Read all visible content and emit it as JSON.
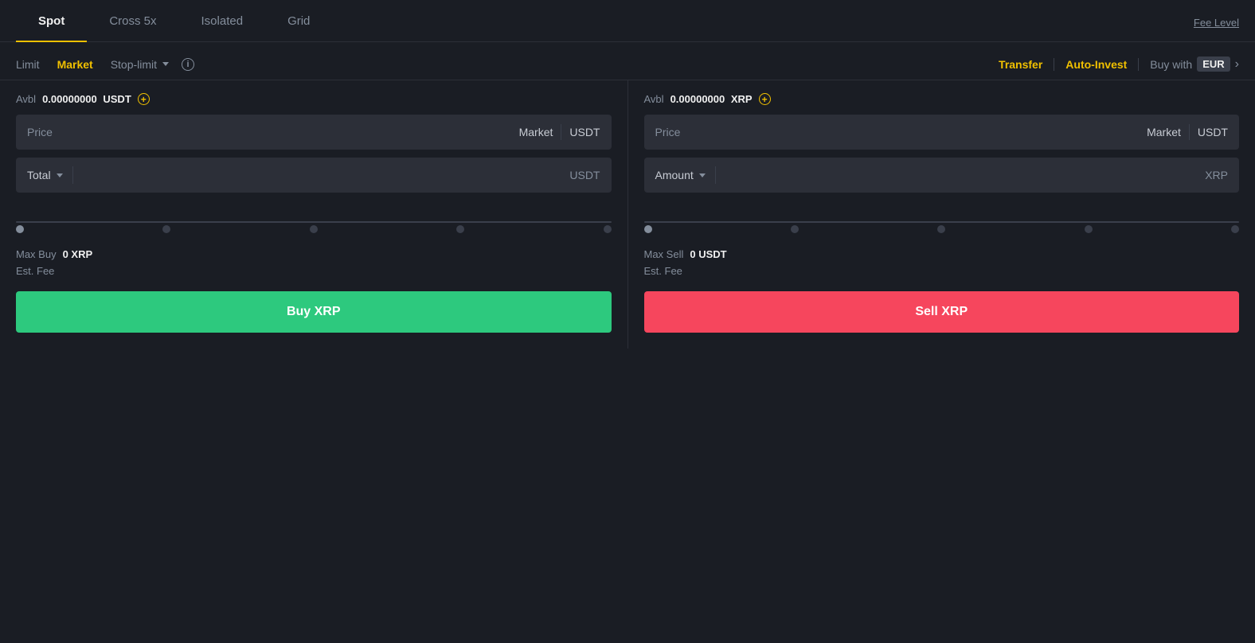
{
  "tabs": [
    {
      "id": "spot",
      "label": "Spot",
      "active": true
    },
    {
      "id": "cross5x",
      "label": "Cross 5x",
      "active": false
    },
    {
      "id": "isolated",
      "label": "Isolated",
      "active": false
    },
    {
      "id": "grid",
      "label": "Grid",
      "active": false
    }
  ],
  "fee_level": "Fee Level",
  "order_types": [
    {
      "id": "limit",
      "label": "Limit",
      "active": false
    },
    {
      "id": "market",
      "label": "Market",
      "active": true
    },
    {
      "id": "stop_limit",
      "label": "Stop-limit",
      "active": false
    }
  ],
  "right_actions": {
    "transfer": "Transfer",
    "auto_invest": "Auto-Invest",
    "buy_with": "Buy with",
    "currency": "EUR"
  },
  "buy_panel": {
    "avbl_label": "Avbl",
    "avbl_amount": "0.00000000",
    "avbl_currency": "USDT",
    "price_placeholder": "Price",
    "price_market": "Market",
    "price_currency": "USDT",
    "total_label": "Total",
    "total_currency": "USDT",
    "max_buy_label": "Max Buy",
    "max_buy_value": "0 XRP",
    "est_fee_label": "Est. Fee",
    "button_label": "Buy XRP"
  },
  "sell_panel": {
    "avbl_label": "Avbl",
    "avbl_amount": "0.00000000",
    "avbl_currency": "XRP",
    "price_placeholder": "Price",
    "price_market": "Market",
    "price_currency": "USDT",
    "amount_label": "Amount",
    "amount_currency": "XRP",
    "max_sell_label": "Max Sell",
    "max_sell_value": "0 USDT",
    "est_fee_label": "Est. Fee",
    "button_label": "Sell XRP"
  }
}
